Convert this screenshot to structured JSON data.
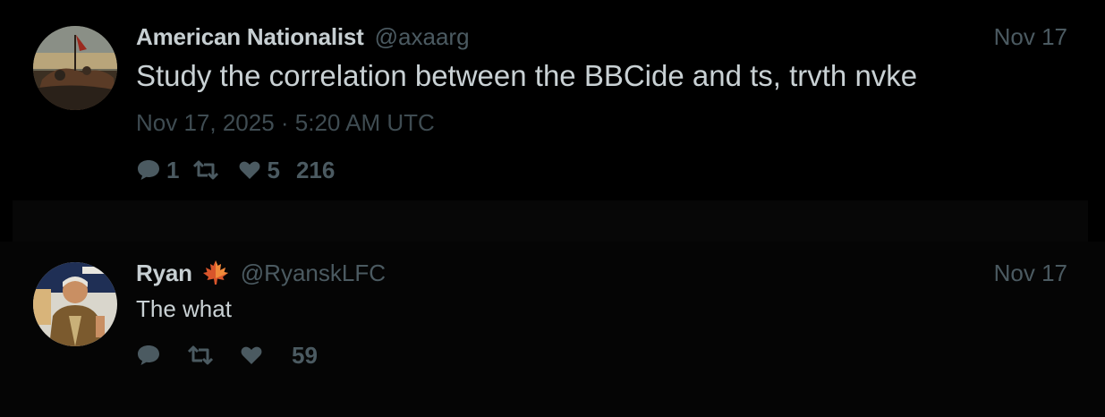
{
  "tweets": [
    {
      "author_name": "American Nationalist",
      "handle": "@axaarg",
      "date": "Nov 17",
      "text": "Study the correlation between the BBCide and ts, trvth nvke",
      "timestamp": "Nov 17, 2025 · 5:20 AM UTC",
      "replies": "1",
      "retweets": "",
      "likes": "5",
      "views": "216"
    },
    {
      "author_name": "Ryan",
      "handle": "@RyanskLFC",
      "date": "Nov 17",
      "text": "The what",
      "replies": "",
      "retweets": "",
      "likes": "",
      "views": "59"
    }
  ]
}
